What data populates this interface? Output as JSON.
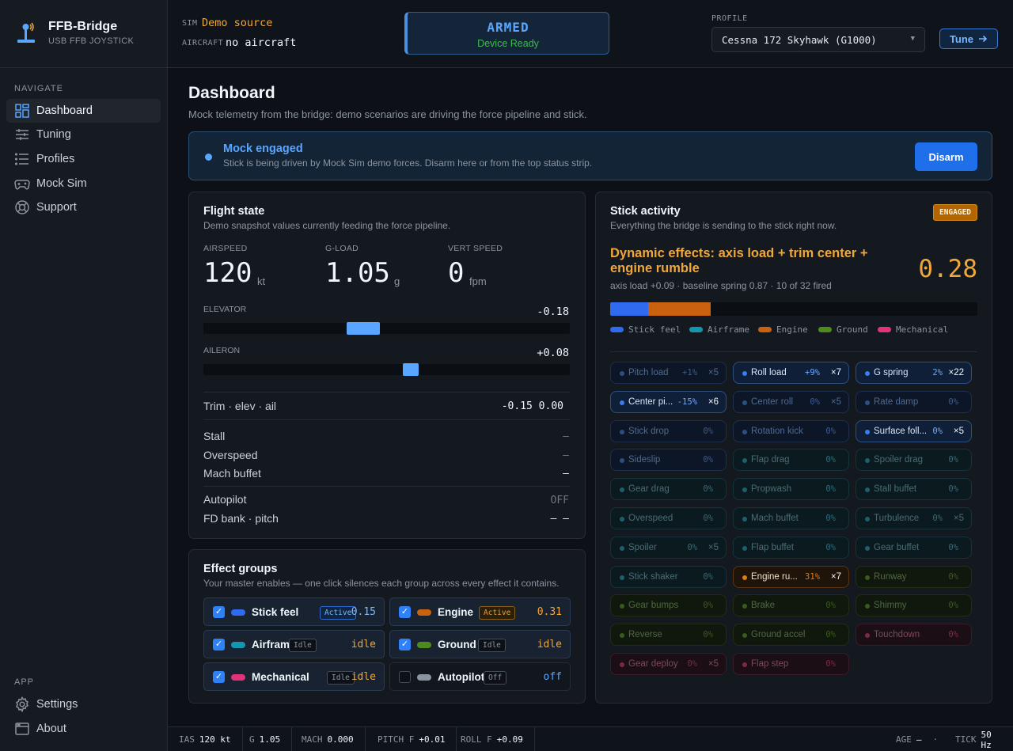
{
  "app": {
    "name": "FFB-Bridge",
    "subtitle": "USB FFB JOYSTICK"
  },
  "sidebar": {
    "navigate_heading": "NAVIGATE",
    "items": [
      {
        "label": "Dashboard",
        "icon": "grid-icon",
        "active": true
      },
      {
        "label": "Tuning",
        "icon": "sliders-icon"
      },
      {
        "label": "Profiles",
        "icon": "list-icon"
      },
      {
        "label": "Mock Sim",
        "icon": "gamepad-icon"
      },
      {
        "label": "Support",
        "icon": "lifebuoy-icon"
      }
    ],
    "app_heading": "APP",
    "app_items": [
      {
        "label": "Settings",
        "icon": "gear-icon"
      },
      {
        "label": "About",
        "icon": "window-icon"
      }
    ]
  },
  "topbar": {
    "sim_label": "SIM",
    "sim_value": "Demo source",
    "aircraft_label": "AIRCRAFT",
    "aircraft_value": "no aircraft",
    "status_title": "ARMED",
    "status_sub": "Device Ready",
    "profile_label": "PROFILE",
    "profile_value": "Cessna 172 Skyhawk (G1000)",
    "tune_label": "Tune"
  },
  "page": {
    "title": "Dashboard",
    "subtitle": "Mock telemetry from the bridge: demo scenarios are driving the force pipeline and stick."
  },
  "banner": {
    "title": "Mock engaged",
    "text": "Stick is being driven by Mock Sim demo forces. Disarm here or from the top status strip.",
    "button": "Disarm"
  },
  "flight_state": {
    "title": "Flight state",
    "subtitle": "Demo snapshot values currently feeding the force pipeline.",
    "airspeed": {
      "label": "AIRSPEED",
      "value": "120",
      "unit": "kt"
    },
    "gload": {
      "label": "G-LOAD",
      "value": "1.05",
      "unit": "g"
    },
    "vspeed": {
      "label": "VERT SPEED",
      "value": "0",
      "unit": "fpm"
    },
    "elevator": {
      "label": "ELEVATOR",
      "value": "-0.18",
      "position": -0.18
    },
    "aileron": {
      "label": "AILERON",
      "value": "+0.08",
      "position": 0.08
    },
    "trim": {
      "label": "Trim · elev · ail",
      "value": "-0.15 0.00"
    },
    "stall": {
      "label": "Stall",
      "value": "—"
    },
    "overspeed": {
      "label": "Overspeed",
      "value": "—"
    },
    "mach_buffet": {
      "label": "Mach buffet",
      "value": "—"
    },
    "autopilot": {
      "label": "Autopilot",
      "value": "OFF"
    },
    "fd": {
      "label": "FD bank · pitch",
      "value": "— —"
    }
  },
  "effect_groups": {
    "title": "Effect groups",
    "subtitle": "Your master enables — one click silences each group across every effect it contains.",
    "groups": [
      {
        "name": "Stick feel",
        "badge": "Active",
        "value": "0.15",
        "color": "#2f6bf0",
        "checked": true
      },
      {
        "name": "Engine",
        "badge": "Active",
        "value": "0.31",
        "color": "#c9620f",
        "checked": true
      },
      {
        "name": "Airframe",
        "badge": "Idle",
        "value": "idle",
        "color": "#1596b0",
        "checked": true
      },
      {
        "name": "Ground",
        "badge": "Idle",
        "value": "idle",
        "color": "#4f8a1c",
        "checked": true
      },
      {
        "name": "Mechanical",
        "badge": "Idle",
        "value": "idle",
        "color": "#e0337a",
        "checked": true
      },
      {
        "name": "Autopilot",
        "badge": "Off",
        "value": "off",
        "color": "#8b949e",
        "checked": false
      }
    ]
  },
  "stick": {
    "title": "Stick activity",
    "subtitle": "Everything the bridge is sending to the stick right now.",
    "badge": "ENGAGED",
    "dyn_title": "Dynamic effects: axis load + trim center + engine rumble",
    "dyn_value": "0.28",
    "dyn_sub": "axis load +0.09 · baseline spring 0.87 · 10 of 32 fired",
    "mix": [
      {
        "share": 0.104,
        "color": "#2f6bf0"
      },
      {
        "share": 0.17,
        "color": "#c9620f"
      }
    ],
    "legend": [
      {
        "label": "Stick feel",
        "color": "#2f6bf0"
      },
      {
        "label": "Airframe",
        "color": "#1596b0"
      },
      {
        "label": "Engine",
        "color": "#c9620f"
      },
      {
        "label": "Ground",
        "color": "#4f8a1c"
      },
      {
        "label": "Mechanical",
        "color": "#e0337a"
      }
    ],
    "effects": [
      {
        "name": "Pitch load",
        "pct": "+1%",
        "count": "×5",
        "group": "stick",
        "active": false
      },
      {
        "name": "Roll load",
        "pct": "+9%",
        "count": "×7",
        "group": "stick",
        "active": true
      },
      {
        "name": "G spring",
        "pct": "2%",
        "count": "×22",
        "group": "stick",
        "active": true
      },
      {
        "name": "Center pi...",
        "pct": "-15%",
        "count": "×6",
        "group": "stick",
        "active": true
      },
      {
        "name": "Center roll",
        "pct": "0%",
        "count": "×5",
        "group": "stick",
        "active": false
      },
      {
        "name": "Rate damp",
        "pct": "0%",
        "count": "",
        "group": "stick",
        "active": false
      },
      {
        "name": "Stick drop",
        "pct": "0%",
        "count": "",
        "group": "stick",
        "active": false
      },
      {
        "name": "Rotation kick",
        "pct": "0%",
        "count": "",
        "group": "stick",
        "active": false
      },
      {
        "name": "Surface foll...",
        "pct": "0%",
        "count": "×5",
        "group": "stick",
        "active": true
      },
      {
        "name": "Sideslip",
        "pct": "0%",
        "count": "",
        "group": "stick",
        "active": false
      },
      {
        "name": "Flap drag",
        "pct": "0%",
        "count": "",
        "group": "air",
        "active": false
      },
      {
        "name": "Spoiler drag",
        "pct": "0%",
        "count": "",
        "group": "air",
        "active": false
      },
      {
        "name": "Gear drag",
        "pct": "0%",
        "count": "",
        "group": "air",
        "active": false
      },
      {
        "name": "Propwash",
        "pct": "0%",
        "count": "",
        "group": "air",
        "active": false
      },
      {
        "name": "Stall buffet",
        "pct": "0%",
        "count": "",
        "group": "air",
        "active": false
      },
      {
        "name": "Overspeed",
        "pct": "0%",
        "count": "",
        "group": "air",
        "active": false
      },
      {
        "name": "Mach buffet",
        "pct": "0%",
        "count": "",
        "group": "air",
        "active": false
      },
      {
        "name": "Turbulence",
        "pct": "0%",
        "count": "×5",
        "group": "air",
        "active": false
      },
      {
        "name": "Spoiler",
        "pct": "0%",
        "count": "×5",
        "group": "air",
        "active": false
      },
      {
        "name": "Flap buffet",
        "pct": "0%",
        "count": "",
        "group": "air",
        "active": false
      },
      {
        "name": "Gear buffet",
        "pct": "0%",
        "count": "",
        "group": "air",
        "active": false
      },
      {
        "name": "Stick shaker",
        "pct": "0%",
        "count": "",
        "group": "air",
        "active": false
      },
      {
        "name": "Engine ru...",
        "pct": "31%",
        "count": "×7",
        "group": "engine",
        "active": true
      },
      {
        "name": "Runway",
        "pct": "0%",
        "count": "",
        "group": "ground",
        "active": false
      },
      {
        "name": "Gear bumps",
        "pct": "0%",
        "count": "",
        "group": "ground",
        "active": false
      },
      {
        "name": "Brake",
        "pct": "0%",
        "count": "",
        "group": "ground",
        "active": false
      },
      {
        "name": "Shimmy",
        "pct": "0%",
        "count": "",
        "group": "ground",
        "active": false
      },
      {
        "name": "Reverse",
        "pct": "0%",
        "count": "",
        "group": "ground",
        "active": false
      },
      {
        "name": "Ground accel",
        "pct": "0%",
        "count": "",
        "group": "ground",
        "active": false
      },
      {
        "name": "Touchdown",
        "pct": "0%",
        "count": "",
        "group": "mech",
        "active": false
      },
      {
        "name": "Gear deploy",
        "pct": "0%",
        "count": "×5",
        "group": "mech",
        "active": false
      },
      {
        "name": "Flap step",
        "pct": "0%",
        "count": "",
        "group": "mech",
        "active": false
      }
    ]
  },
  "statusbar": {
    "ias": {
      "label": "IAS",
      "value": "120 kt"
    },
    "g": {
      "label": "G",
      "value": "1.05"
    },
    "mach": {
      "label": "MACH",
      "value": "0.000"
    },
    "pitch": {
      "label": "PITCH F",
      "value": "+0.01"
    },
    "roll": {
      "label": "ROLL F",
      "value": "+0.09"
    },
    "age": {
      "label": "AGE",
      "value": "—",
      "sep": "·"
    },
    "tick": {
      "label": "TICK",
      "value": "50 Hz"
    }
  }
}
